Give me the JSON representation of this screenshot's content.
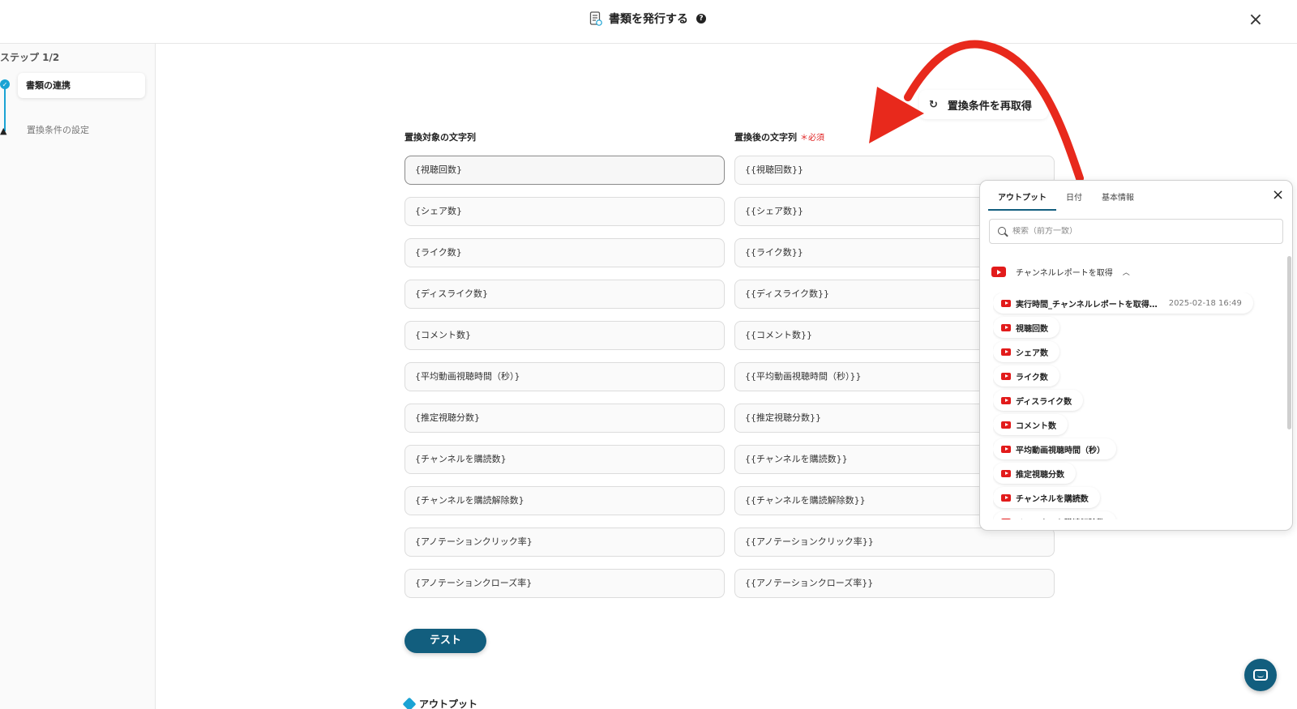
{
  "header": {
    "title": "書類を発行する",
    "help_icon": "?",
    "close_icon": "×"
  },
  "sidebar": {
    "step_label": "ステップ 1/2",
    "steps": [
      {
        "label": "書類の連携",
        "status": "done"
      },
      {
        "label": "置換条件の設定",
        "status": "warning"
      }
    ]
  },
  "refetch": {
    "label": "置換条件を再取得"
  },
  "form": {
    "left_header": "置換対象の文字列",
    "right_header": "置換後の文字列",
    "required_mark": "＊必須",
    "rows": [
      {
        "source": "{視聴回数}",
        "target": "{{視聴回数}}"
      },
      {
        "source": "{シェア数}",
        "target": "{{シェア数}}"
      },
      {
        "source": "{ライク数}",
        "target": "{{ライク数}}"
      },
      {
        "source": "{ディスライク数}",
        "target": "{{ディスライク数}}"
      },
      {
        "source": "{コメント数}",
        "target": "{{コメント数}}"
      },
      {
        "source": "{平均動画視聴時間（秒）}",
        "target": "{{平均動画視聴時間（秒）}}"
      },
      {
        "source": "{推定視聴分数}",
        "target": "{{推定視聴分数}}"
      },
      {
        "source": "{チャンネルを購読数}",
        "target": "{{チャンネルを購読数}}"
      },
      {
        "source": "{チャンネルを購読解除数}",
        "target": "{{チャンネルを購読解除数}}"
      },
      {
        "source": "{アノテーションクリック率}",
        "target": "{{アノテーションクリック率}}"
      },
      {
        "source": "{アノテーションクローズ率}",
        "target": "{{アノテーションクローズ率}}"
      }
    ],
    "test_button": "テスト",
    "output_label": "アウトプット"
  },
  "panel": {
    "tabs": [
      "アウトプット",
      "日付",
      "基本情報"
    ],
    "active_tab": 0,
    "close_icon": "×",
    "search_placeholder": "検索（前方一致）",
    "group_title": "チャンネルレポートを取得",
    "items": [
      {
        "label": "実行時間_チャンネルレポートを取得…",
        "value": "2025-02-18 16:49"
      },
      {
        "label": "視聴回数",
        "value": ""
      },
      {
        "label": "シェア数",
        "value": ""
      },
      {
        "label": "ライク数",
        "value": ""
      },
      {
        "label": "ディスライク数",
        "value": ""
      },
      {
        "label": "コメント数",
        "value": ""
      },
      {
        "label": "平均動画視聴時間（秒）",
        "value": ""
      },
      {
        "label": "推定視聴分数",
        "value": ""
      },
      {
        "label": "チャンネルを購読数",
        "value": ""
      },
      {
        "label": "チャンネルを購読解除数",
        "value": ""
      }
    ]
  },
  "colors": {
    "accent": "#125e7e",
    "step_blue": "#1ba3d4",
    "annotation_arrow": "#e8291c",
    "youtube_red": "#e21b1b",
    "required_red": "#e02020"
  }
}
